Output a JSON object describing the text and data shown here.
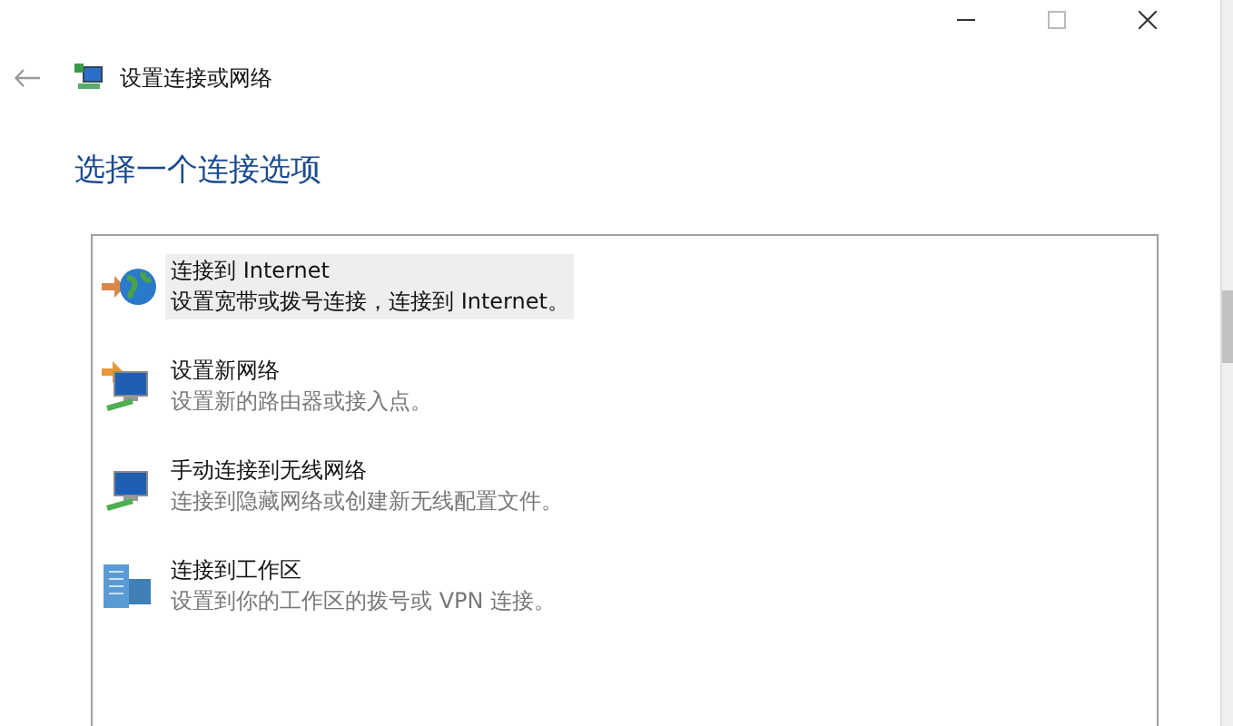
{
  "window": {
    "title": "设置连接或网络"
  },
  "heading": "选择一个连接选项",
  "options": [
    {
      "kind": "internet",
      "title": "连接到 Internet",
      "description": "设置宽带或拨号连接，连接到 Internet。",
      "selected": true
    },
    {
      "kind": "new-network",
      "title": "设置新网络",
      "description": "设置新的路由器或接入点。",
      "selected": false
    },
    {
      "kind": "wireless",
      "title": "手动连接到无线网络",
      "description": "连接到隐藏网络或创建新无线配置文件。",
      "selected": false
    },
    {
      "kind": "workplace",
      "title": "连接到工作区",
      "description": "设置到你的工作区的拨号或 VPN 连接。",
      "selected": false
    }
  ]
}
